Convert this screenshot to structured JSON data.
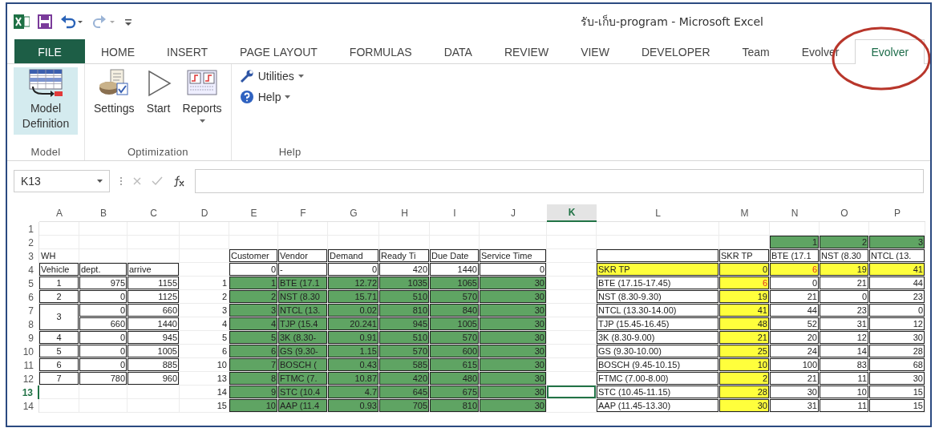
{
  "window": {
    "title": "รับ-เก็บ-program - Microsoft Excel"
  },
  "tabs": [
    {
      "label": "FILE",
      "kind": "file",
      "selected": false
    },
    {
      "label": "HOME",
      "kind": "tab",
      "selected": false
    },
    {
      "label": "INSERT",
      "kind": "tab",
      "selected": false
    },
    {
      "label": "PAGE LAYOUT",
      "kind": "tab",
      "selected": false
    },
    {
      "label": "FORMULAS",
      "kind": "tab",
      "selected": false
    },
    {
      "label": "DATA",
      "kind": "tab",
      "selected": false
    },
    {
      "label": "REVIEW",
      "kind": "tab",
      "selected": false
    },
    {
      "label": "VIEW",
      "kind": "tab",
      "selected": false
    },
    {
      "label": "DEVELOPER",
      "kind": "tab",
      "selected": false
    },
    {
      "label": "Team",
      "kind": "tab",
      "selected": false
    },
    {
      "label": "Evolver",
      "kind": "tab",
      "selected": false
    },
    {
      "label": "Evolver",
      "kind": "tab",
      "selected": true
    }
  ],
  "annotation": {
    "kind": "ellipse"
  },
  "ribbon": {
    "groups": [
      {
        "label": "Model",
        "buttons": [
          {
            "label": "Model Definition",
            "kind": "large",
            "pressed": true,
            "dropdown": false
          }
        ]
      },
      {
        "label": "Optimization",
        "buttons": [
          {
            "label": "Settings",
            "kind": "large",
            "pressed": false,
            "dropdown": false
          },
          {
            "label": "Start",
            "kind": "large",
            "pressed": false,
            "dropdown": false
          },
          {
            "label": "Reports",
            "kind": "large",
            "pressed": false,
            "dropdown": true
          }
        ]
      },
      {
        "label": "Help",
        "buttons": [
          {
            "label": "Utilities",
            "kind": "small",
            "pressed": false,
            "dropdown": true
          },
          {
            "label": "Help",
            "kind": "small",
            "pressed": false,
            "dropdown": true
          }
        ]
      }
    ]
  },
  "formula_bar": {
    "name_box": "K13"
  },
  "sheet": {
    "columns": [
      {
        "label": "A",
        "selected": false
      },
      {
        "label": "B",
        "selected": false
      },
      {
        "label": "C",
        "selected": false
      },
      {
        "label": "D",
        "selected": false
      },
      {
        "label": "E",
        "selected": false
      },
      {
        "label": "F",
        "selected": false
      },
      {
        "label": "G",
        "selected": false
      },
      {
        "label": "H",
        "selected": false
      },
      {
        "label": "I",
        "selected": false
      },
      {
        "label": "J",
        "selected": false
      },
      {
        "label": "K",
        "selected": true
      },
      {
        "label": "L",
        "selected": false
      },
      {
        "label": "M",
        "selected": false
      },
      {
        "label": "N",
        "selected": false
      },
      {
        "label": "O",
        "selected": false
      },
      {
        "label": "P",
        "selected": false
      }
    ],
    "rows": [
      {
        "label": "1",
        "selected": false,
        "cells": [
          null,
          null,
          null,
          null,
          null,
          null,
          null,
          null,
          null,
          null,
          null,
          null,
          null,
          null,
          null,
          null
        ]
      },
      {
        "label": "2",
        "selected": false,
        "cells": [
          null,
          null,
          null,
          null,
          null,
          null,
          null,
          null,
          null,
          null,
          null,
          null,
          null,
          {
            "text": "1",
            "boxed": true,
            "color": "#5fa463"
          },
          {
            "text": "2",
            "boxed": true,
            "color": "#5fa463"
          },
          {
            "text": "3",
            "boxed": true,
            "color": "#5fa463"
          }
        ]
      },
      {
        "label": "3",
        "selected": false,
        "cells": [
          {
            "text": "WH",
            "boxed": false
          },
          null,
          null,
          null,
          {
            "text": "Customer",
            "boxed": true
          },
          {
            "text": "Vendor",
            "boxed": true
          },
          {
            "text": "Demand",
            "boxed": true
          },
          {
            "text": "Ready Ti",
            "boxed": true
          },
          {
            "text": "Due Date",
            "boxed": true
          },
          {
            "text": "Service Time",
            "boxed": true
          },
          null,
          {
            "boxed": true
          },
          {
            "text": "SKR TP",
            "boxed": true
          },
          {
            "text": "BTE (17.1",
            "boxed": true
          },
          {
            "text": "NST (8.30",
            "boxed": true
          },
          {
            "text": "NTCL (13.",
            "boxed": true
          }
        ]
      },
      {
        "label": "4",
        "selected": false,
        "cells": [
          {
            "text": "Vehicle",
            "boxed": true
          },
          {
            "text": "dept.",
            "boxed": true
          },
          {
            "text": "arrive",
            "boxed": true
          },
          null,
          {
            "text": "0",
            "boxed": true
          },
          {
            "text": "-",
            "boxed": true
          },
          {
            "text": "0",
            "boxed": true
          },
          {
            "text": "420",
            "boxed": true
          },
          {
            "text": "1440",
            "boxed": true
          },
          {
            "text": "0",
            "boxed": true
          },
          null,
          {
            "text": "SKR TP",
            "boxed": true,
            "color": "#ffff3c"
          },
          {
            "text": "0",
            "boxed": true,
            "color": "#ffff3c"
          },
          {
            "text": "6",
            "boxed": true,
            "color": "#ffff3c",
            "red_text": true
          },
          {
            "text": "19",
            "boxed": true,
            "color": "#ffff3c"
          },
          {
            "text": "41",
            "boxed": true,
            "color": "#ffff3c"
          }
        ]
      },
      {
        "label": "5",
        "selected": false,
        "cells": [
          {
            "text": "1",
            "boxed": true
          },
          {
            "text": "975",
            "boxed": true
          },
          {
            "text": "1155",
            "boxed": true
          },
          {
            "text": "1",
            "boxed": false
          },
          {
            "text": "1",
            "boxed": true,
            "color": "#5fa463"
          },
          {
            "text": "BTE (17.1",
            "boxed": true,
            "color": "#5fa463"
          },
          {
            "text": "12.72",
            "boxed": true,
            "color": "#5fa463"
          },
          {
            "text": "1035",
            "boxed": true,
            "color": "#5fa463"
          },
          {
            "text": "1065",
            "boxed": true,
            "color": "#5fa463"
          },
          {
            "text": "30",
            "boxed": true,
            "color": "#5fa463"
          },
          null,
          {
            "text": "BTE (17.15-17.45)",
            "boxed": true
          },
          {
            "text": "6",
            "boxed": true,
            "color": "#ffff3c",
            "red_text": true
          },
          {
            "text": "0",
            "boxed": true
          },
          {
            "text": "21",
            "boxed": true
          },
          {
            "text": "44",
            "boxed": true
          }
        ]
      },
      {
        "label": "6",
        "selected": false,
        "cells": [
          {
            "text": "2",
            "boxed": true
          },
          {
            "text": "0",
            "boxed": true
          },
          {
            "text": "1125",
            "boxed": true
          },
          {
            "text": "2",
            "boxed": false
          },
          {
            "text": "2",
            "boxed": true,
            "color": "#5fa463"
          },
          {
            "text": "NST (8.30",
            "boxed": true,
            "color": "#5fa463"
          },
          {
            "text": "15.71",
            "boxed": true,
            "color": "#5fa463"
          },
          {
            "text": "510",
            "boxed": true,
            "color": "#5fa463"
          },
          {
            "text": "570",
            "boxed": true,
            "color": "#5fa463"
          },
          {
            "text": "30",
            "boxed": true,
            "color": "#5fa463"
          },
          null,
          {
            "text": "NST (8.30-9.30)",
            "boxed": true
          },
          {
            "text": "19",
            "boxed": true,
            "color": "#ffff3c"
          },
          {
            "text": "21",
            "boxed": true
          },
          {
            "text": "0",
            "boxed": true
          },
          {
            "text": "23",
            "boxed": true
          }
        ]
      },
      {
        "label": "7",
        "selected": false,
        "cells": [
          {
            "text": "3",
            "boxed": true,
            "rowspan": 2
          },
          {
            "text": "0",
            "boxed": true
          },
          {
            "text": "660",
            "boxed": true
          },
          {
            "text": "3",
            "boxed": false
          },
          {
            "text": "3",
            "boxed": true,
            "color": "#5fa463"
          },
          {
            "text": "NTCL (13.",
            "boxed": true,
            "color": "#5fa463"
          },
          {
            "text": "0.02",
            "boxed": true,
            "color": "#5fa463"
          },
          {
            "text": "810",
            "boxed": true,
            "color": "#5fa463"
          },
          {
            "text": "840",
            "boxed": true,
            "color": "#5fa463"
          },
          {
            "text": "30",
            "boxed": true,
            "color": "#5fa463"
          },
          null,
          {
            "text": "NTCL (13.30-14.00)",
            "boxed": true
          },
          {
            "text": "41",
            "boxed": true,
            "color": "#ffff3c"
          },
          {
            "text": "44",
            "boxed": true
          },
          {
            "text": "23",
            "boxed": true
          },
          {
            "text": "0",
            "boxed": true
          }
        ]
      },
      {
        "label": "8",
        "selected": false,
        "cells": [
          {
            "text": "660",
            "boxed": true
          },
          {
            "text": "1440",
            "boxed": true
          },
          {
            "text": "4",
            "boxed": false
          },
          {
            "text": "4",
            "boxed": true,
            "color": "#5fa463"
          },
          {
            "text": "TJP (15.4",
            "boxed": true,
            "color": "#5fa463"
          },
          {
            "text": "20.241",
            "boxed": true,
            "color": "#5fa463"
          },
          {
            "text": "945",
            "boxed": true,
            "color": "#5fa463"
          },
          {
            "text": "1005",
            "boxed": true,
            "color": "#5fa463"
          },
          {
            "text": "30",
            "boxed": true,
            "color": "#5fa463"
          },
          null,
          {
            "text": "TJP (15.45-16.45)",
            "boxed": true
          },
          {
            "text": "48",
            "boxed": true,
            "color": "#ffff3c"
          },
          {
            "text": "52",
            "boxed": true
          },
          {
            "text": "31",
            "boxed": true
          },
          {
            "text": "12",
            "boxed": true
          }
        ]
      },
      {
        "label": "9",
        "selected": false,
        "cells": [
          {
            "text": "4",
            "boxed": true
          },
          {
            "text": "0",
            "boxed": true
          },
          {
            "text": "945",
            "boxed": true
          },
          {
            "text": "5",
            "boxed": false
          },
          {
            "text": "5",
            "boxed": true,
            "color": "#5fa463"
          },
          {
            "text": "3K (8.30-",
            "boxed": true,
            "color": "#5fa463"
          },
          {
            "text": "0.91",
            "boxed": true,
            "color": "#5fa463"
          },
          {
            "text": "510",
            "boxed": true,
            "color": "#5fa463"
          },
          {
            "text": "570",
            "boxed": true,
            "color": "#5fa463"
          },
          {
            "text": "30",
            "boxed": true,
            "color": "#5fa463"
          },
          null,
          {
            "text": "3K (8.30-9.00)",
            "boxed": true
          },
          {
            "text": "21",
            "boxed": true,
            "color": "#ffff3c"
          },
          {
            "text": "20",
            "boxed": true
          },
          {
            "text": "12",
            "boxed": true
          },
          {
            "text": "30",
            "boxed": true
          }
        ]
      },
      {
        "label": "10",
        "selected": false,
        "cells": [
          {
            "text": "5",
            "boxed": true
          },
          {
            "text": "0",
            "boxed": true
          },
          {
            "text": "1005",
            "boxed": true
          },
          {
            "text": "6",
            "boxed": false
          },
          {
            "text": "6",
            "boxed": true,
            "color": "#5fa463"
          },
          {
            "text": "GS (9.30-",
            "boxed": true,
            "color": "#5fa463"
          },
          {
            "text": "1.15",
            "boxed": true,
            "color": "#5fa463"
          },
          {
            "text": "570",
            "boxed": true,
            "color": "#5fa463"
          },
          {
            "text": "600",
            "boxed": true,
            "color": "#5fa463"
          },
          {
            "text": "30",
            "boxed": true,
            "color": "#5fa463"
          },
          null,
          {
            "text": "GS (9.30-10.00)",
            "boxed": true
          },
          {
            "text": "25",
            "boxed": true,
            "color": "#ffff3c"
          },
          {
            "text": "24",
            "boxed": true
          },
          {
            "text": "14",
            "boxed": true
          },
          {
            "text": "28",
            "boxed": true
          }
        ]
      },
      {
        "label": "11",
        "selected": false,
        "cells": [
          {
            "text": "6",
            "boxed": true
          },
          {
            "text": "0",
            "boxed": true
          },
          {
            "text": "885",
            "boxed": true
          },
          {
            "text": "10",
            "boxed": false
          },
          {
            "text": "7",
            "boxed": true,
            "color": "#5fa463"
          },
          {
            "text": "BOSCH (",
            "boxed": true,
            "color": "#5fa463"
          },
          {
            "text": "0.43",
            "boxed": true,
            "color": "#5fa463"
          },
          {
            "text": "585",
            "boxed": true,
            "color": "#5fa463"
          },
          {
            "text": "615",
            "boxed": true,
            "color": "#5fa463"
          },
          {
            "text": "30",
            "boxed": true,
            "color": "#5fa463"
          },
          null,
          {
            "text": "BOSCH (9.45-10.15)",
            "boxed": true
          },
          {
            "text": "10",
            "boxed": true,
            "color": "#ffff3c"
          },
          {
            "text": "100",
            "boxed": true
          },
          {
            "text": "83",
            "boxed": true
          },
          {
            "text": "68",
            "boxed": true
          }
        ]
      },
      {
        "label": "12",
        "selected": false,
        "cells": [
          {
            "text": "7",
            "boxed": true
          },
          {
            "text": "780",
            "boxed": true
          },
          {
            "text": "960",
            "boxed": true
          },
          {
            "text": "13",
            "boxed": false
          },
          {
            "text": "8",
            "boxed": true,
            "color": "#5fa463"
          },
          {
            "text": "FTMC (7.",
            "boxed": true,
            "color": "#5fa463"
          },
          {
            "text": "10.87",
            "boxed": true,
            "color": "#5fa463"
          },
          {
            "text": "420",
            "boxed": true,
            "color": "#5fa463"
          },
          {
            "text": "480",
            "boxed": true,
            "color": "#5fa463"
          },
          {
            "text": "30",
            "boxed": true,
            "color": "#5fa463"
          },
          null,
          {
            "text": "FTMC (7.00-8.00)",
            "boxed": true
          },
          {
            "text": "2",
            "boxed": true,
            "color": "#ffff3c"
          },
          {
            "text": "21",
            "boxed": true
          },
          {
            "text": "11",
            "boxed": true
          },
          {
            "text": "30",
            "boxed": true
          }
        ]
      },
      {
        "label": "13",
        "selected": true,
        "cells": [
          null,
          null,
          null,
          {
            "text": "14",
            "boxed": false
          },
          {
            "text": "9",
            "boxed": true,
            "color": "#5fa463"
          },
          {
            "text": "STC (10.4",
            "boxed": true,
            "color": "#5fa463"
          },
          {
            "text": "4.7",
            "boxed": true,
            "color": "#5fa463"
          },
          {
            "text": "645",
            "boxed": true,
            "color": "#5fa463"
          },
          {
            "text": "675",
            "boxed": true,
            "color": "#5fa463"
          },
          {
            "text": "30",
            "boxed": true,
            "color": "#5fa463"
          },
          null,
          {
            "text": "STC (10.45-11.15)",
            "boxed": true
          },
          {
            "text": "28",
            "boxed": true,
            "color": "#ffff3c"
          },
          {
            "text": "30",
            "boxed": true
          },
          {
            "text": "10",
            "boxed": true
          },
          {
            "text": "15",
            "boxed": true
          }
        ]
      },
      {
        "label": "14",
        "selected": false,
        "cells": [
          null,
          null,
          null,
          {
            "text": "15",
            "boxed": false
          },
          {
            "text": "10",
            "boxed": true,
            "color": "#5fa463"
          },
          {
            "text": "AAP (11.4",
            "boxed": true,
            "color": "#5fa463"
          },
          {
            "text": "0.93",
            "boxed": true,
            "color": "#5fa463"
          },
          {
            "text": "705",
            "boxed": true,
            "color": "#5fa463"
          },
          {
            "text": "810",
            "boxed": true,
            "color": "#5fa463"
          },
          {
            "text": "30",
            "boxed": true,
            "color": "#5fa463"
          },
          null,
          {
            "text": "AAP (11.45-13.30)",
            "boxed": true
          },
          {
            "text": "30",
            "boxed": true,
            "color": "#ffff3c"
          },
          {
            "text": "31",
            "boxed": true
          },
          {
            "text": "11",
            "boxed": true
          },
          {
            "text": "15",
            "boxed": true
          }
        ]
      }
    ]
  }
}
